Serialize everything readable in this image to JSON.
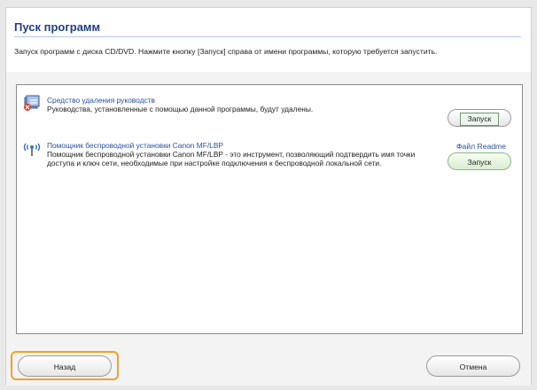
{
  "window": {
    "title": "Пуск программ",
    "description": "Запуск программ с диска CD/DVD. Нажмите кнопку [Запуск] справа от имени программы, которую требуется запустить."
  },
  "programs": [
    {
      "name": "Средство удаления руководств",
      "text": "Руководства, установленные с помощью данной программы, будут удалены.",
      "icon": "uninstall-icon",
      "run_label": "Запуск"
    },
    {
      "name": "Помощник беспроводной установки Canon MF/LBP",
      "text": "Помощник беспроводной установки Canon MF/LBP - это инструмент, позволяющий подтвердить имя точки доступа и ключ сети, необходимые при настройке подключения к беспроводной локальной сети.",
      "icon": "wireless-icon",
      "readme_label": "Файл Readme",
      "run_label": "Запуск"
    }
  ],
  "footer": {
    "back_label": "Назад",
    "cancel_label": "Отмена"
  },
  "colors": {
    "title": "#1f3d8a",
    "link": "#2a4fa3",
    "focus": "#f0a030"
  }
}
